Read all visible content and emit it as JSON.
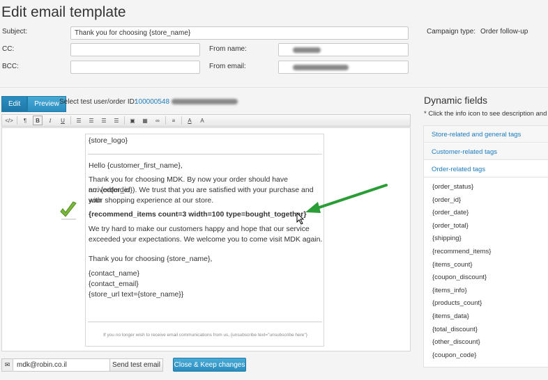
{
  "page_title": "Edit email template",
  "form": {
    "subject_label": "Subject:",
    "subject_value": "Thank you for choosing {store_name}",
    "cc_label": "CC:",
    "bcc_label": "BCC:",
    "from_name_label": "From name:",
    "from_email_label": "From email:",
    "campaign_type_label": "Campaign type:",
    "campaign_type_value": "Order follow-up"
  },
  "editor": {
    "edit_label": "Edit",
    "preview_label": "Preview",
    "test_user_label": "Select test user/order ID:",
    "test_order_id": "100000548",
    "toolbar_icons": [
      "code-icon",
      "paragraph-icon",
      "bold-icon",
      "italic-icon",
      "underline-icon",
      "bullet-list-icon",
      "numbered-list-icon",
      "outdent-icon",
      "indent-icon",
      "image-icon",
      "table-icon",
      "link-icon",
      "align-icon",
      "text-color-icon",
      "font-size-icon"
    ]
  },
  "email": {
    "logo": "{store_logo}",
    "greeting": "Hello {customer_first_name},",
    "p1_l1": "Thank you for choosing MDK. By now your order should have arrived(order",
    "p1_l2": "no. {order_id}). We trust that you are satisfied with your purchase and with",
    "p1_l3": "your shopping experience at our store.",
    "recommend": "{recommend_items count=3 width=100 type=bought_together}",
    "p2_l1": "We try hard to make our customers happy and hope that our service",
    "p2_l2": "exceeded your expectations. We welcome you to come visit MDK  again.",
    "thanks": "Thank you for choosing {store_name},",
    "contact_name": "{contact_name}",
    "contact_email": "{contact_email}",
    "store_url": "{store_url text={store_name}}",
    "footer": "If you no longer wish to receive email communications from us, {unsubscribe text=\"unsubscribe here\"}"
  },
  "bottom": {
    "email_value": "mdk@robin.co.il",
    "send_test_label": "Send test email",
    "close_keep_label": "Close & Keep changes"
  },
  "dynamic": {
    "title": "Dynamic fields",
    "hint": "* Click the info icon to see description and",
    "groups": [
      "Store-related and general tags",
      "Customer-related tags",
      "Order-related tags"
    ],
    "tags": [
      "{order_status}",
      "{order_id}",
      "{order_date}",
      "{order_total}",
      "{shipping}",
      "{recommend_items}",
      "{items_count}",
      "{coupon_discount}",
      "{items_info}",
      "{products_count}",
      "{items_data}",
      "{total_discount}",
      "{other_discount}",
      "{coupon_code}"
    ]
  }
}
